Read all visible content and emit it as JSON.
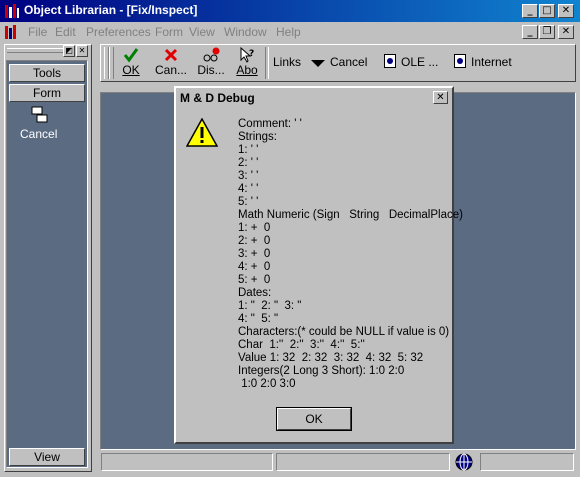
{
  "window": {
    "title": "Object Librarian - [Fix/Inspect]"
  },
  "menu": [
    "File",
    "Edit",
    "Preferences",
    "Form",
    "View",
    "Window",
    "Help"
  ],
  "sidebar": {
    "tools_label": "Tools",
    "form_label": "Form",
    "cancel_label": "Cancel",
    "view_label": "View"
  },
  "toolbar": {
    "ok_label": "OK",
    "cancel_label": "Can...",
    "display_label": "Dis...",
    "about_label": "Abo",
    "links_label": "Links",
    "cancel_link_label": "Cancel",
    "ole_label": "OLE ...",
    "internet_label": "Internet"
  },
  "dialog": {
    "title": "M & D Debug",
    "ok_label": "OK",
    "lines": [
      "Comment: ' '",
      "Strings:",
      "1: ' '",
      "2: ' '",
      "3: ' '",
      "4: ' '",
      "5: ' '",
      "Math Numeric (Sign   String   DecimalPlace)",
      "1: +  0",
      "2: +  0",
      "3: +  0",
      "4: +  0",
      "5: +  0",
      "Dates:",
      "1: \"  2: \"  3: \"",
      "4: \"  5: \"",
      "Characters:(* could be NULL if value is 0)",
      "Char  1:''  2:''  3:''  4:''  5:''",
      "Value 1: 32  2: 32  3: 32  4: 32  5: 32",
      "Integers(2 Long 3 Short): 1:0 2:0",
      " 1:0 2:0 3:0"
    ]
  }
}
